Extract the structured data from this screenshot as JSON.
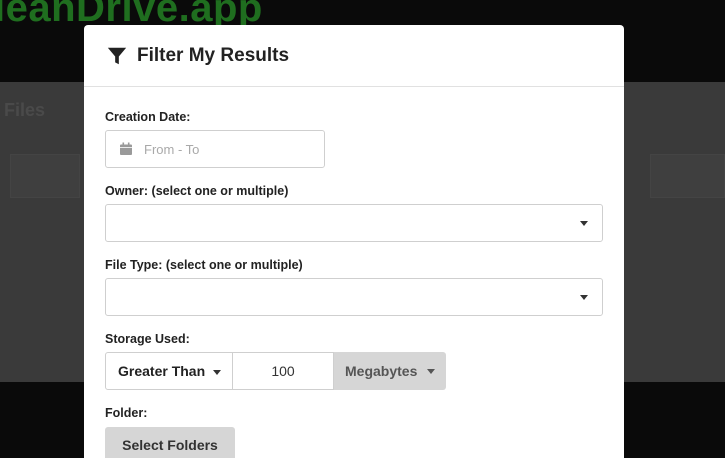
{
  "background": {
    "brand": "leanDrive.app",
    "section_title": "Files"
  },
  "modal": {
    "title": "Filter My Results",
    "title_icon": "filter-icon",
    "creation_date": {
      "label": "Creation Date:",
      "placeholder": "From - To",
      "icon": "calendar-icon"
    },
    "owner": {
      "label": "Owner: (select one or multiple)",
      "value": ""
    },
    "file_type": {
      "label": "File Type: (select one or multiple)",
      "value": ""
    },
    "storage": {
      "label": "Storage Used:",
      "comparison": "Greater Than",
      "amount": "100",
      "unit": "Megabytes"
    },
    "folder": {
      "label": "Folder:",
      "button": "Select Folders"
    }
  }
}
